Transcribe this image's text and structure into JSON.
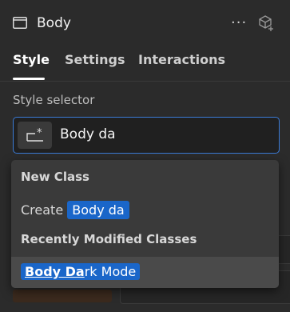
{
  "header": {
    "title": "Body",
    "more_label": "···",
    "icons": {
      "box": "box-icon",
      "component": "component-icon"
    }
  },
  "tabs": [
    {
      "label": "Style",
      "active": true
    },
    {
      "label": "Settings",
      "active": false
    },
    {
      "label": "Interactions",
      "active": false
    }
  ],
  "style_selector": {
    "label": "Style selector",
    "value": "Body da",
    "icon": "selector-icon",
    "accent": "#3b7bd6"
  },
  "dropdown": {
    "new_class_heading": "New Class",
    "create_prefix": "Create",
    "create_value": "Body da",
    "recent_heading": "Recently Modified Classes",
    "recent_items": [
      {
        "match": "Body Da",
        "rest": "rk Mode"
      }
    ],
    "chip_color": "#1a66c9"
  }
}
